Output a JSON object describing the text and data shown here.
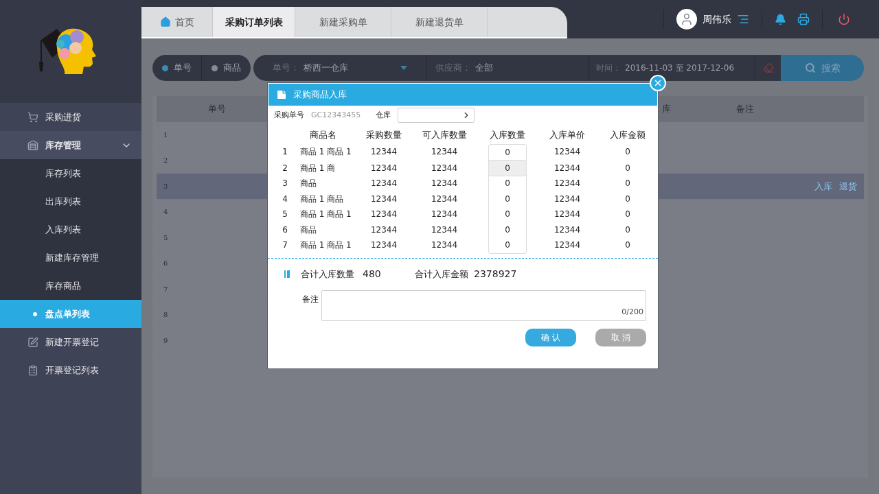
{
  "sidebar": {
    "items": [
      {
        "label": "采购进货",
        "expanded": false
      },
      {
        "label": "库存管理",
        "expanded": true,
        "children": [
          {
            "label": "库存列表",
            "selected": false
          },
          {
            "label": "出库列表",
            "selected": false
          },
          {
            "label": "入库列表",
            "selected": false
          },
          {
            "label": "新建库存管理",
            "selected": false
          },
          {
            "label": "库存商品",
            "selected": false
          },
          {
            "label": "盘点单列表",
            "selected": true
          }
        ]
      },
      {
        "label": "新建开票登记",
        "expanded": false
      },
      {
        "label": "开票登记列表",
        "expanded": false
      }
    ]
  },
  "tabs": [
    {
      "label": "首页",
      "selected": false
    },
    {
      "label": "采购订单列表",
      "selected": true
    },
    {
      "label": "新建采购单",
      "selected": false
    },
    {
      "label": "新建退货单",
      "selected": false
    }
  ],
  "user": {
    "name": "周伟乐"
  },
  "search": {
    "modes": [
      {
        "label": "单号",
        "selected": true
      },
      {
        "label": "商品",
        "selected": false
      }
    ],
    "order": {
      "label": "单号：",
      "value": "桥西一仓库"
    },
    "supplier": {
      "label": "供应商：",
      "value": "全部"
    },
    "time": {
      "label": "时间：",
      "value": "2016-11-03 至 2017-12-06"
    },
    "button": "搜索"
  },
  "table": {
    "columns": [
      "单号",
      "库",
      "备注"
    ],
    "rows": [
      {
        "index": "1",
        "selected": false,
        "actions": []
      },
      {
        "index": "2",
        "selected": false,
        "actions": []
      },
      {
        "index": "3",
        "selected": true,
        "actions": [
          "入库",
          "退货"
        ]
      },
      {
        "index": "4",
        "selected": false,
        "actions": []
      },
      {
        "index": "5",
        "selected": false,
        "actions": []
      },
      {
        "index": "6",
        "selected": false,
        "actions": []
      },
      {
        "index": "7",
        "selected": false,
        "actions": []
      },
      {
        "index": "8",
        "selected": false,
        "actions": []
      },
      {
        "index": "9",
        "selected": false,
        "actions": []
      }
    ]
  },
  "dialog": {
    "title": "采购商品入库",
    "order_label": "采购单号",
    "order_no": "GC12343455",
    "warehouse_label": "仓库",
    "columns": [
      "商品名",
      "采购数量",
      "可入库数量",
      "入库数量",
      "入库单价",
      "入库金额"
    ],
    "rows": [
      {
        "index": "1",
        "name": "商品 1 商品 1",
        "purchase_qty": "12344",
        "available_qty": "12344",
        "qty": "0",
        "focused": false,
        "price": "12344",
        "amount": "0"
      },
      {
        "index": "2",
        "name": "商品 1 商",
        "purchase_qty": "12344",
        "available_qty": "12344",
        "qty": "0",
        "focused": true,
        "price": "12344",
        "amount": "0"
      },
      {
        "index": "3",
        "name": "商品",
        "purchase_qty": "12344",
        "available_qty": "12344",
        "qty": "0",
        "focused": false,
        "price": "12344",
        "amount": "0"
      },
      {
        "index": "4",
        "name": "商品 1 商品",
        "purchase_qty": "12344",
        "available_qty": "12344",
        "qty": "0",
        "focused": false,
        "price": "12344",
        "amount": "0"
      },
      {
        "index": "5",
        "name": "商品 1 商品 1",
        "purchase_qty": "12344",
        "available_qty": "12344",
        "qty": "0",
        "focused": false,
        "price": "12344",
        "amount": "0"
      },
      {
        "index": "6",
        "name": "商品",
        "purchase_qty": "12344",
        "available_qty": "12344",
        "qty": "0",
        "focused": false,
        "price": "12344",
        "amount": "0"
      },
      {
        "index": "7",
        "name": "商品 1 商品 1",
        "purchase_qty": "12344",
        "available_qty": "12344",
        "qty": "0",
        "focused": false,
        "price": "12344",
        "amount": "0"
      }
    ],
    "total_qty_label": "合计入库数量",
    "total_qty": "480",
    "total_amount_label": "合计入库金额",
    "total_amount": "2378927",
    "remark_label": "备注",
    "remark_counter": "0/200",
    "confirm": "确 认",
    "cancel": "取 消"
  }
}
